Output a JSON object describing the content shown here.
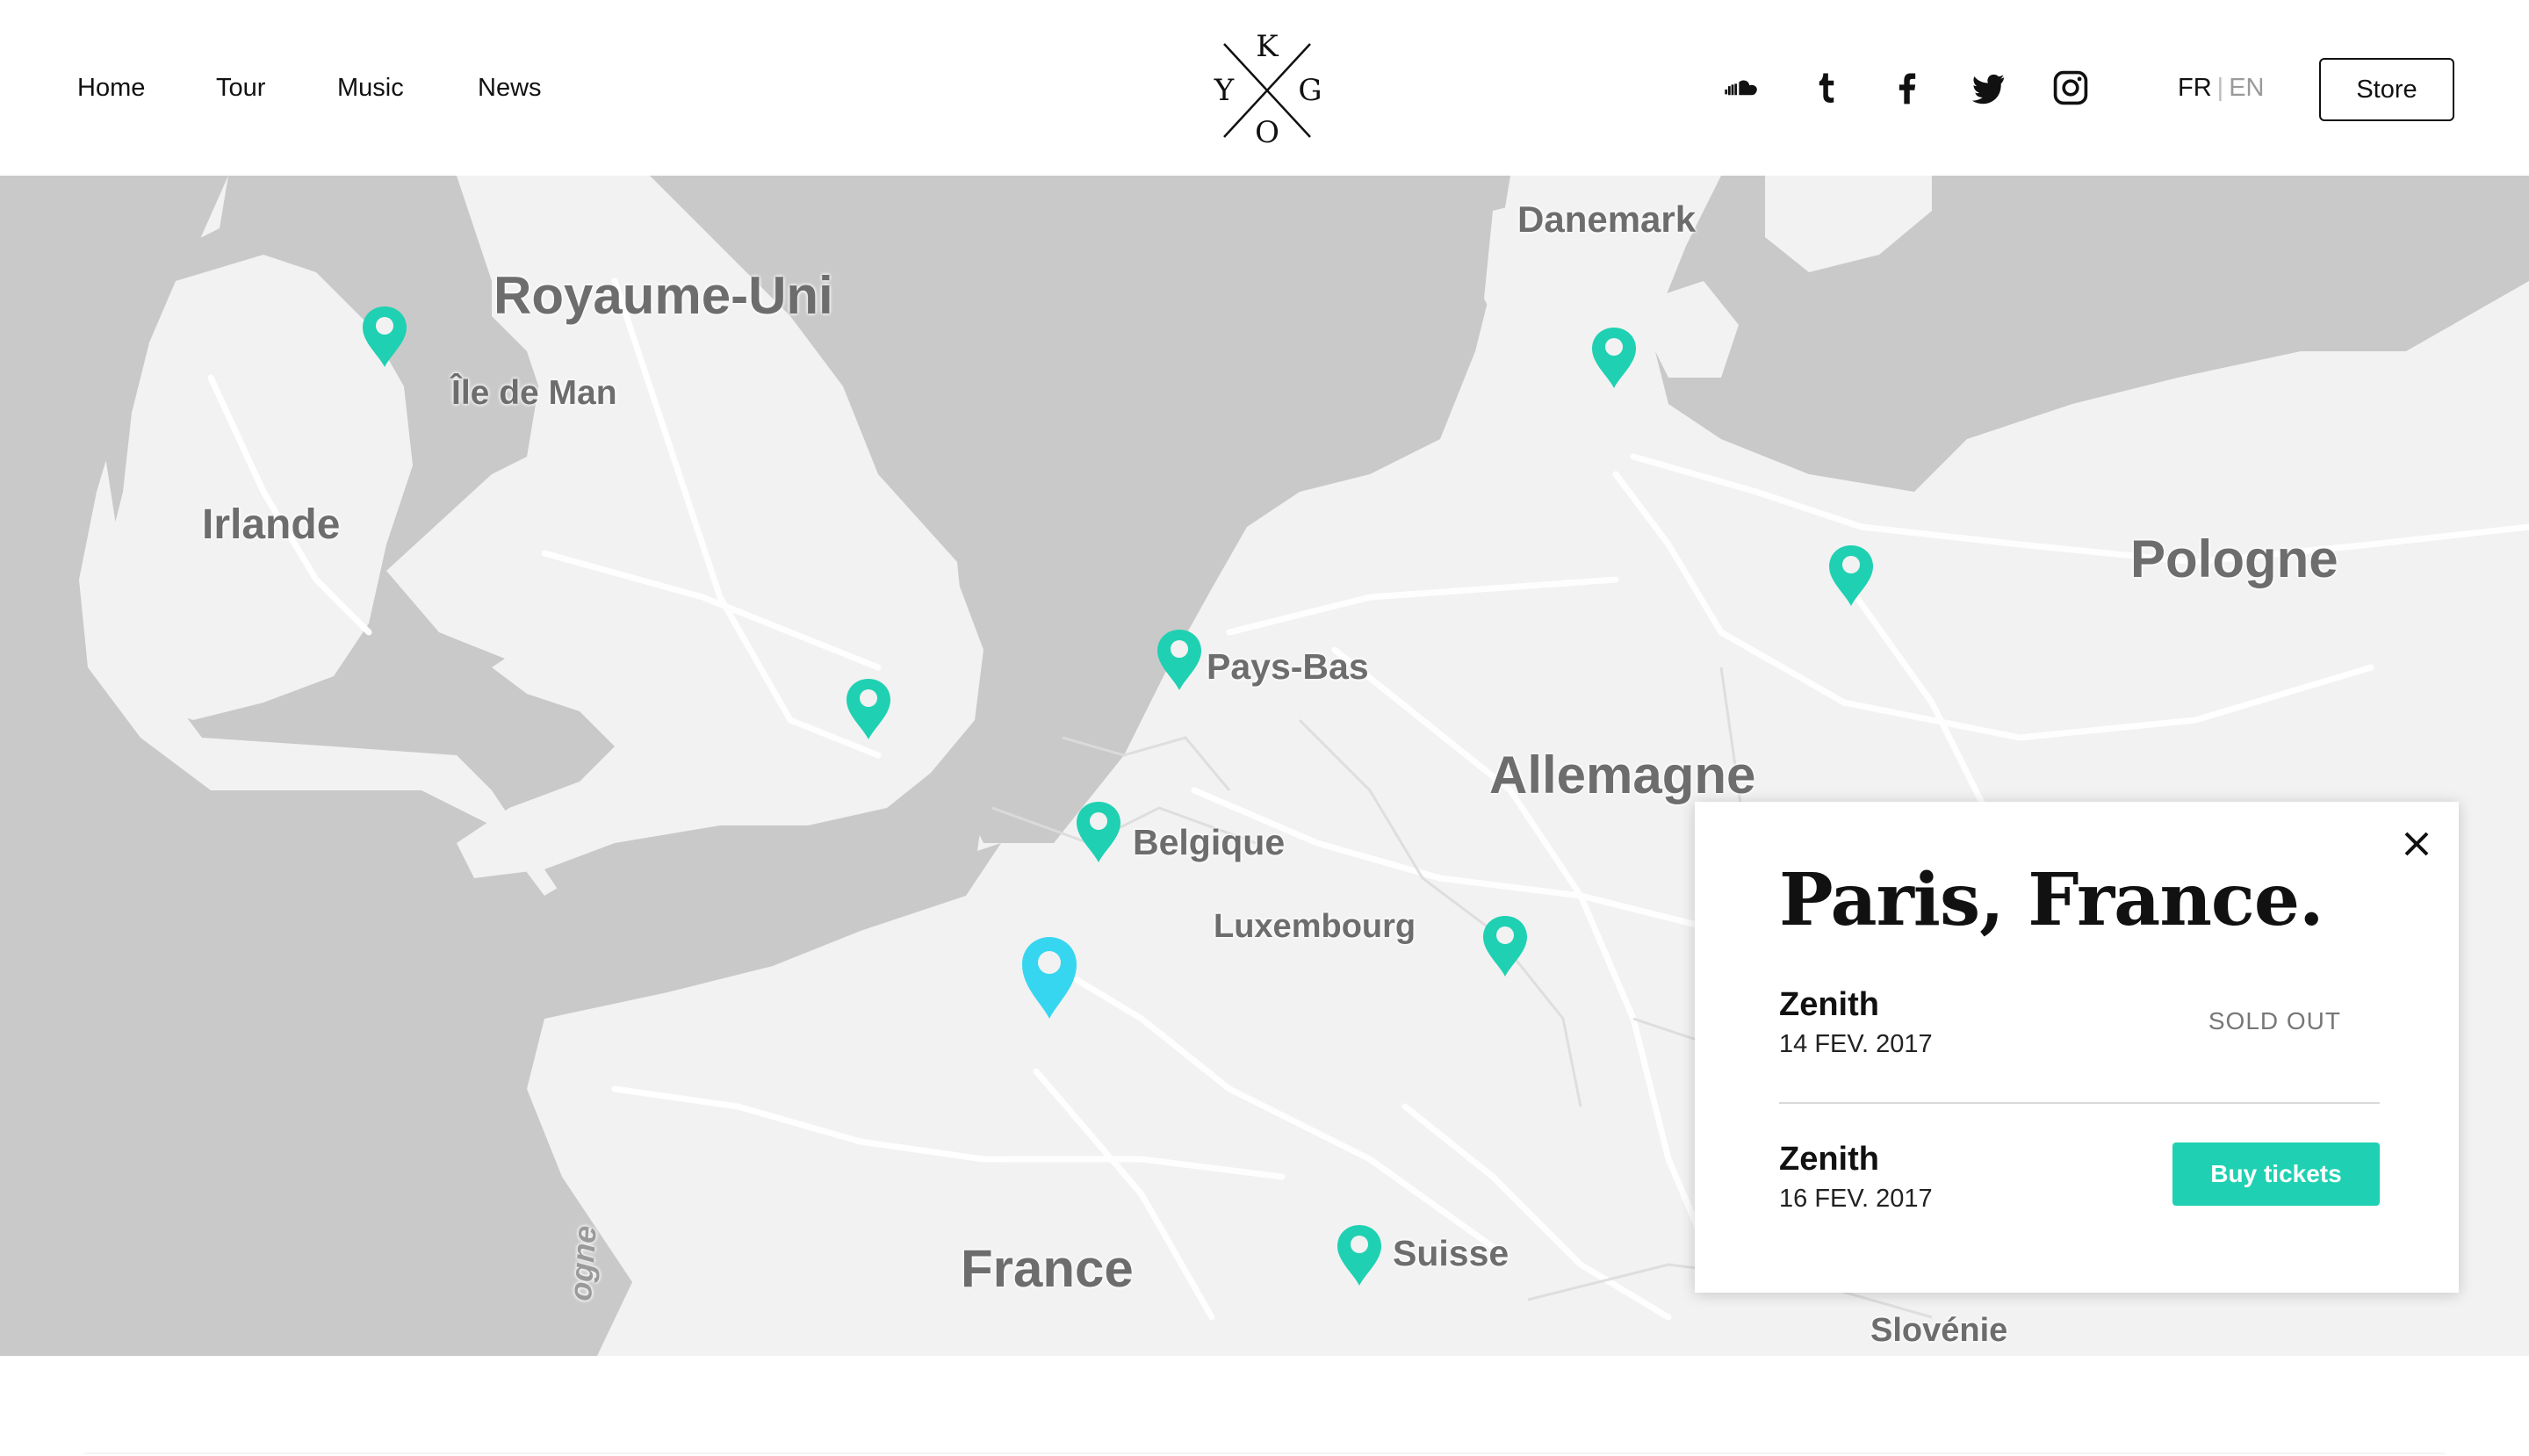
{
  "nav": {
    "items": [
      {
        "label": "Home"
      },
      {
        "label": "Tour"
      },
      {
        "label": "Music"
      },
      {
        "label": "News"
      }
    ]
  },
  "logo": {
    "letters": {
      "top": "K",
      "left": "Y",
      "right": "G",
      "bottom": "O"
    }
  },
  "social": {
    "icons": [
      "soundcloud-icon",
      "tumblr-icon",
      "facebook-icon",
      "twitter-icon",
      "instagram-icon"
    ]
  },
  "lang": {
    "fr": "FR",
    "separator": "|",
    "en": "EN",
    "active": "FR"
  },
  "store": {
    "label": "Store"
  },
  "map": {
    "labels": {
      "royaume_uni": "Royaume-Uni",
      "ile_de_man": "Île de Man",
      "irlande": "Irlande",
      "danemark": "Danemark",
      "pologne": "Pologne",
      "pays_bas": "Pays-Bas",
      "allemagne": "Allemagne",
      "belgique": "Belgique",
      "luxembourg": "Luxembourg",
      "france": "France",
      "suisse": "Suisse",
      "slovenie": "Slovénie",
      "bologne_partial": "ogne"
    },
    "marker_color": "#1fd1b2",
    "active_marker_color": "#36d6f0",
    "land_color": "#f2f2f2",
    "sea_color": "#c9c9c9"
  },
  "popup": {
    "title": "Paris, France.",
    "shows": [
      {
        "venue": "Zenith",
        "date": "14 FEV. 2017",
        "status": "SOLD OUT"
      },
      {
        "venue": "Zenith",
        "date": "16 FEV. 2017",
        "action": "Buy tickets"
      }
    ]
  },
  "colors": {
    "accent": "#1fd1b2",
    "text": "#111111"
  }
}
